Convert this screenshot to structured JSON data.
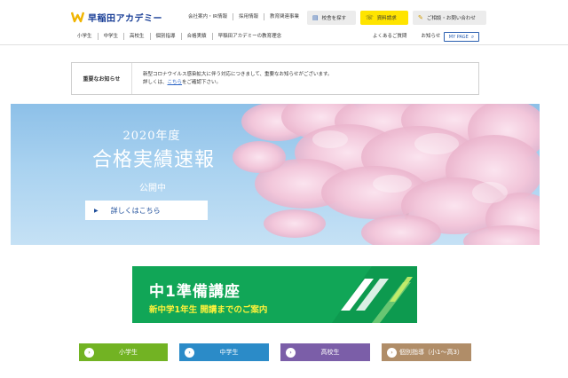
{
  "header": {
    "logo_text": "早稲田アカデミー",
    "util_links": [
      "会社案内・IR情報",
      "採用情報",
      "教育関連事業"
    ],
    "school_search_label": "校舎を探す",
    "docs_request_label": "資料請求",
    "contact_label": "ご相談・お問い合わせ"
  },
  "nav": {
    "items": [
      "小学生",
      "中学生",
      "高校生",
      "個別指導",
      "合格実績",
      "早稲田アカデミーの教育理念"
    ],
    "faq_label": "よくあるご質問",
    "news_label": "お知らせ",
    "mypage_label": "MY PAGE"
  },
  "notice": {
    "label": "重要なお知らせ",
    "line1": "新型コロナウイルス感染拡大に伴う対応につきまして、重要なお知らせがございます。",
    "line2_prefix": "詳しくは、",
    "line2_link": "こちら",
    "line2_suffix": "をご確認下さい。"
  },
  "hero": {
    "year": "2020年度",
    "title": "合格実績速報",
    "subtitle": "公開中",
    "button_label": "詳しくはこちら"
  },
  "banner": {
    "title": "中1準備講座",
    "subtitle": "新中学1年生 開講までのご案内"
  },
  "categories": [
    {
      "label": "小学生",
      "color": "#72b323"
    },
    {
      "label": "中学生",
      "color": "#2b8bc8"
    },
    {
      "label": "高校生",
      "color": "#7b5ea8"
    },
    {
      "label": "個別指導（小1〜高3）",
      "color": "#b08d68"
    }
  ],
  "colors": {
    "brand_blue": "#1a3f97",
    "brand_yellow": "#ffe400",
    "banner_green": "#11a657",
    "link_blue": "#2a63c6"
  },
  "icons": {
    "school_search": "document-search-icon",
    "docs_request": "headset-icon",
    "contact": "chat-icon",
    "mypage": "search-icon",
    "hero_button": "play-triangle-icon",
    "category": "chevron-right-circle-icon"
  }
}
